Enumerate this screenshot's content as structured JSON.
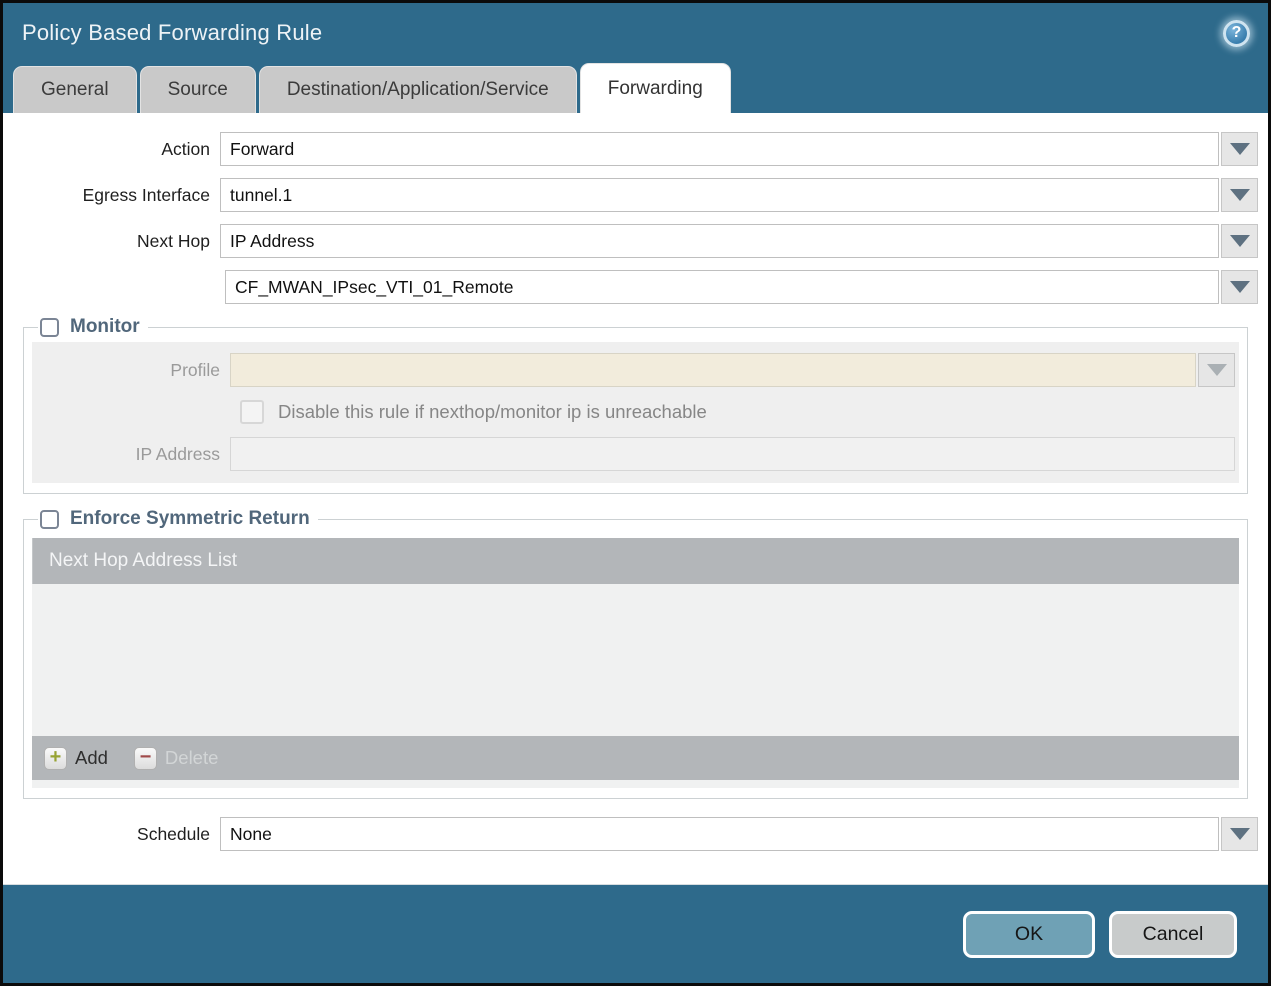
{
  "dialog": {
    "title": "Policy Based Forwarding Rule"
  },
  "help_icon": {
    "glyph": "?"
  },
  "tabs": [
    {
      "label": "General",
      "active": false
    },
    {
      "label": "Source",
      "active": false
    },
    {
      "label": "Destination/Application/Service",
      "active": false
    },
    {
      "label": "Forwarding",
      "active": true
    }
  ],
  "form": {
    "action": {
      "label": "Action",
      "value": "Forward"
    },
    "egress_interface": {
      "label": "Egress Interface",
      "value": "tunnel.1"
    },
    "next_hop": {
      "label": "Next Hop",
      "value": "IP Address"
    },
    "next_hop_address": {
      "value": "CF_MWAN_IPsec_VTI_01_Remote"
    },
    "schedule": {
      "label": "Schedule",
      "value": "None"
    }
  },
  "monitor": {
    "legend": "Monitor",
    "checked": false,
    "profile": {
      "label": "Profile",
      "value": ""
    },
    "disable_rule_checkbox": {
      "label": "Disable this rule if nexthop/monitor ip is unreachable",
      "checked": false
    },
    "ip_address": {
      "label": "IP Address",
      "value": ""
    }
  },
  "symmetric_return": {
    "legend": "Enforce Symmetric Return",
    "checked": false,
    "table": {
      "header": "Next Hop Address List",
      "rows": []
    },
    "add_label": "Add",
    "delete_label": "Delete"
  },
  "footer": {
    "ok_label": "OK",
    "cancel_label": "Cancel"
  },
  "colors": {
    "teal": "#2e6a8b",
    "ok_button": "#6fa1b5",
    "cancel_button": "#c8cbcb",
    "legend_text": "#51677b",
    "disabled_profile_field": "#f2ecdc",
    "table_header": "#b3b6b9"
  }
}
